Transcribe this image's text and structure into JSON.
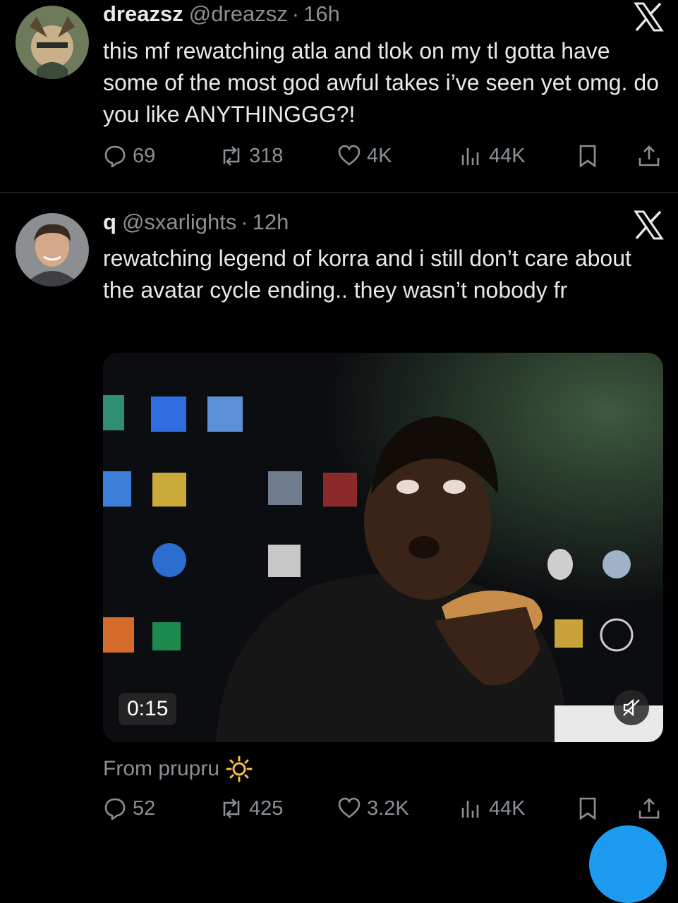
{
  "tweets": [
    {
      "display_name": "dreazsz",
      "handle": "@dreazsz",
      "separator": "·",
      "time": "16h",
      "text": "this mf rewatching atla and tlok on my tl gotta have some of the most god awful takes i’ve seen yet omg. do you like ANYTHINGGG?!",
      "stats": {
        "replies": "69",
        "reposts": "318",
        "likes": "4K",
        "views": "44K"
      }
    },
    {
      "display_name": "q",
      "handle": "@sxarlights",
      "separator": "·",
      "time": "12h",
      "text": "rewatching legend of korra and i still don’t care about the avatar cycle ending.. they wasn’t nobody fr",
      "video": {
        "duration": "0:15"
      },
      "from_label": "From prupru",
      "stats": {
        "replies": "52",
        "reposts": "425",
        "likes": "3.2K",
        "views": "44K"
      }
    }
  ],
  "colors": {
    "accent": "#1d9bf0",
    "muted": "#8b9096",
    "text": "#e7e9ea",
    "background": "#000000"
  }
}
